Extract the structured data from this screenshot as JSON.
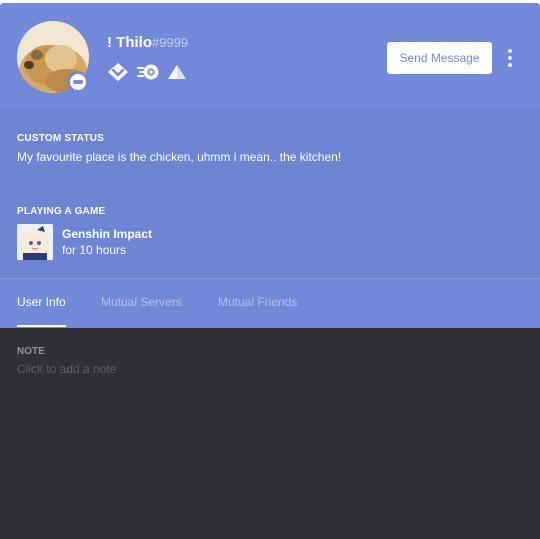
{
  "profile": {
    "username": "! Thilo",
    "discriminator": "#9999",
    "status": "dnd",
    "avatar_icon": "doge-avatar",
    "badges": [
      {
        "icon": "hypesquad-balance-icon"
      },
      {
        "icon": "nitro-icon"
      },
      {
        "icon": "server-boost-icon"
      }
    ]
  },
  "header": {
    "send_message_label": "Send Message",
    "more_icon": "more-vertical-icon"
  },
  "custom_status": {
    "label": "CUSTOM STATUS",
    "text": "My favourite place is the chicken, uhmm i mean.. the kitchen!"
  },
  "activity": {
    "label": "PLAYING A GAME",
    "game_name": "Genshin Impact",
    "duration": "for 10 hours",
    "icon": "genshin-impact-game-icon"
  },
  "tabs": [
    {
      "label": "User Info",
      "active": true
    },
    {
      "label": "Mutual Servers",
      "active": false
    },
    {
      "label": "Mutual Friends",
      "active": false
    }
  ],
  "note": {
    "label": "NOTE",
    "placeholder": "Click to add a note"
  },
  "colors": {
    "blurple": "#7289da",
    "blurple_dark": "#6e85d3",
    "background": "#2f3136",
    "white": "#ffffff"
  }
}
